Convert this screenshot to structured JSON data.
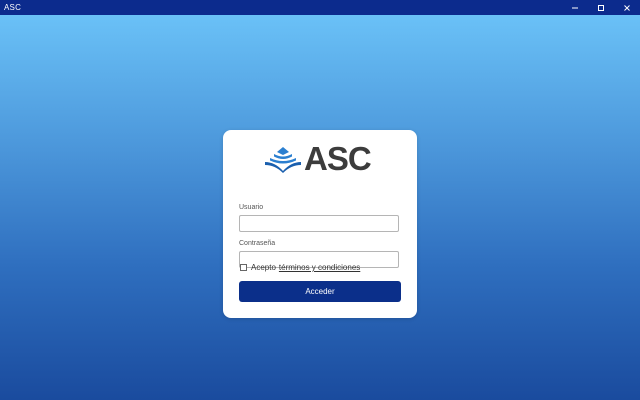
{
  "window": {
    "title": "ASC",
    "titlebar_color": "#0c2b8d",
    "controls": [
      "minimize-icon",
      "maximize-icon",
      "close-icon"
    ]
  },
  "background": {
    "gradient_top": "#6ac1f7",
    "gradient_bottom": "#1a4b9e"
  },
  "logo": {
    "text": "ASC",
    "icon": "book-waves-icon",
    "icon_color": "#2b7fd0"
  },
  "form": {
    "username": {
      "label": "Usuario",
      "value": "",
      "placeholder": ""
    },
    "password": {
      "label": "Contraseña",
      "value": "",
      "placeholder": ""
    },
    "terms": {
      "checked": false,
      "prefix": "Acepto",
      "link_text": "términos y condiciones"
    },
    "submit_label": "Acceder",
    "accent": "#0b2f8a"
  }
}
